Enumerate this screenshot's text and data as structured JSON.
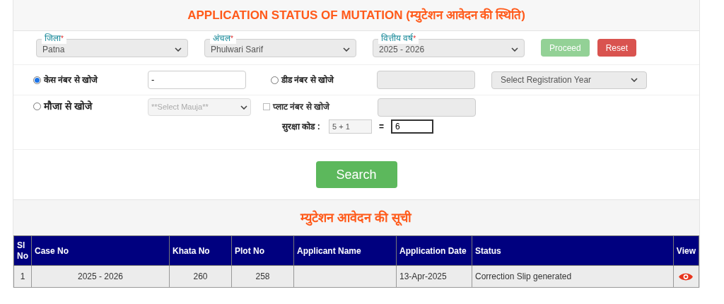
{
  "title": "APPLICATION STATUS OF MUTATION (म्युटेशन आवेदन की स्थिति)",
  "selects": [
    {
      "label": "जिला",
      "required_mark": "*",
      "value": "Patna"
    },
    {
      "label": "अंचल",
      "required_mark": "*",
      "value": "Phulwari Sarif"
    },
    {
      "label": "वित्तीय वर्ष",
      "required_mark": "*",
      "value": "2025 - 2026"
    }
  ],
  "buttons": [
    {
      "label": "Proceed",
      "kind": "success",
      "disabled": true
    },
    {
      "label": "Reset",
      "kind": "danger",
      "disabled": false
    }
  ],
  "search_options": [
    {
      "kind": "radio",
      "label": "केस नंबर से खोजे",
      "selected": true,
      "value": "-"
    },
    {
      "kind": "radio",
      "label": "डीड नंबर से खोजे",
      "selected": false,
      "year_placeholder": "Select Registration Year"
    },
    {
      "kind": "radio",
      "label": "मौजा से खोजे",
      "selected": false,
      "mauja_placeholder": "**Select Mauja**"
    },
    {
      "kind": "checkbox",
      "label": "प्लाट नंबर से खोजे",
      "checked": false
    }
  ],
  "captcha": {
    "label": "सुरक्षा कोड :",
    "question": "5 + 1",
    "equals": "=",
    "answer": "6"
  },
  "search_button": "Search",
  "list_title": "म्युटेशन आवेदन की सूची",
  "table": {
    "columns": [
      "Sl No",
      "Case No",
      "Khata No",
      "Plot No",
      "Applicant Name",
      "Application Date",
      "Status",
      "View"
    ],
    "rows": [
      {
        "sl_no": "1",
        "case_no": "2025 - 2026",
        "khata_no": "260",
        "plot_no": "258",
        "application_date": "13-Apr-2025",
        "status": "Correction Slip generated"
      }
    ]
  }
}
